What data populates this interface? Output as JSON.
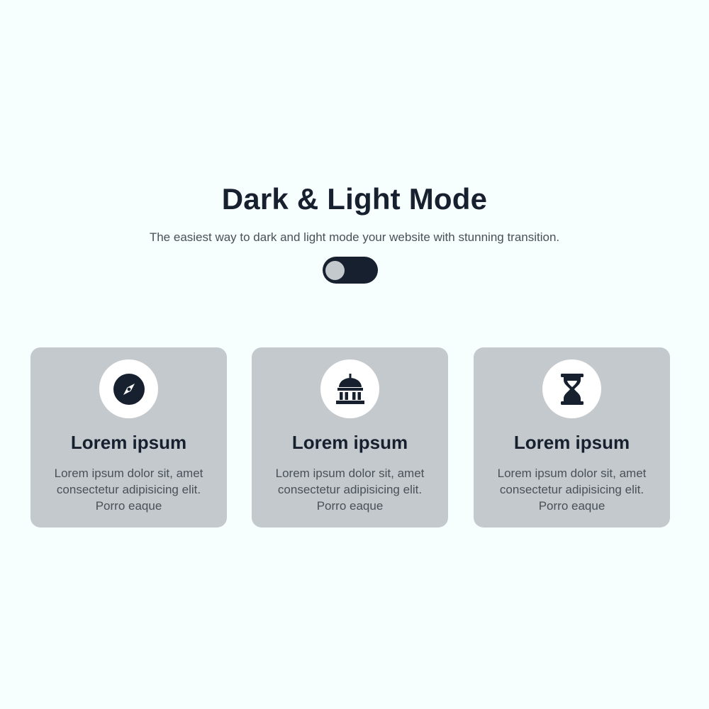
{
  "hero": {
    "title": "Dark & Light Mode",
    "subtitle": "The easiest way to dark and light mode your website with stunning transition."
  },
  "toggle": {
    "state": "off"
  },
  "colors": {
    "background": "#f7fefe",
    "dark": "#16202e",
    "card": "#c4c9cd",
    "text_muted": "#4a5058"
  },
  "cards": [
    {
      "icon": "compass-icon",
      "title": "Lorem ipsum",
      "text": "Lorem ipsum dolor sit, amet consectetur adipisicing elit. Porro eaque"
    },
    {
      "icon": "landmark-icon",
      "title": "Lorem ipsum",
      "text": "Lorem ipsum dolor sit, amet consectetur adipisicing elit. Porro eaque"
    },
    {
      "icon": "hourglass-icon",
      "title": "Lorem ipsum",
      "text": "Lorem ipsum dolor sit, amet consectetur adipisicing elit. Porro eaque"
    }
  ]
}
